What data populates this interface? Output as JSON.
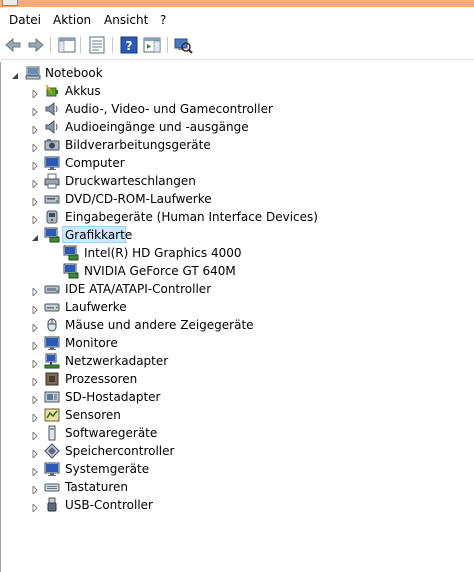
{
  "menubar": {
    "items": [
      {
        "label": "Datei"
      },
      {
        "label": "Aktion"
      },
      {
        "label": "Ansicht"
      },
      {
        "label": "?"
      }
    ]
  },
  "toolbar": {
    "buttons": [
      {
        "icon": "back-arrow-icon"
      },
      {
        "icon": "forward-arrow-icon"
      },
      {
        "icon": "console-tree-icon"
      },
      {
        "icon": "properties-icon"
      },
      {
        "icon": "help-icon"
      },
      {
        "icon": "action-pane-icon"
      },
      {
        "icon": "scan-hardware-icon"
      }
    ]
  },
  "tree": {
    "root": {
      "label": "Notebook",
      "icon": "computer-icon",
      "expanded": true
    },
    "categories": [
      {
        "label": "Akkus",
        "icon": "battery-icon",
        "expanded": false
      },
      {
        "label": "Audio-, Video- und Gamecontroller",
        "icon": "speaker-icon",
        "expanded": false
      },
      {
        "label": "Audioeingänge und -ausgänge",
        "icon": "speaker-icon",
        "expanded": false
      },
      {
        "label": "Bildverarbeitungsgeräte",
        "icon": "camera-icon",
        "expanded": false
      },
      {
        "label": "Computer",
        "icon": "monitor-icon",
        "expanded": false
      },
      {
        "label": "Druckwarteschlangen",
        "icon": "printer-icon",
        "expanded": false
      },
      {
        "label": "DVD/CD-ROM-Laufwerke",
        "icon": "disc-drive-icon",
        "expanded": false
      },
      {
        "label": "Eingabegeräte (Human Interface Devices)",
        "icon": "hid-icon",
        "expanded": false
      },
      {
        "label": "Grafikkarte",
        "icon": "display-adapter-icon",
        "expanded": true,
        "selected": true,
        "children": [
          {
            "label": "Intel(R) HD Graphics 4000",
            "icon": "display-adapter-icon"
          },
          {
            "label": "NVIDIA GeForce GT 640M",
            "icon": "display-adapter-icon"
          }
        ]
      },
      {
        "label": "IDE ATA/ATAPI-Controller",
        "icon": "ide-controller-icon",
        "expanded": false
      },
      {
        "label": "Laufwerke",
        "icon": "hard-drive-icon",
        "expanded": false
      },
      {
        "label": "Mäuse und andere Zeigegeräte",
        "icon": "mouse-icon",
        "expanded": false
      },
      {
        "label": "Monitore",
        "icon": "monitor-icon",
        "expanded": false
      },
      {
        "label": "Netzwerkadapter",
        "icon": "network-icon",
        "expanded": false
      },
      {
        "label": "Prozessoren",
        "icon": "processor-icon",
        "expanded": false
      },
      {
        "label": "SD-Hostadapter",
        "icon": "sd-card-icon",
        "expanded": false
      },
      {
        "label": "Sensoren",
        "icon": "sensor-icon",
        "expanded": false
      },
      {
        "label": "Softwaregeräte",
        "icon": "software-device-icon",
        "expanded": false
      },
      {
        "label": "Speichercontroller",
        "icon": "storage-controller-icon",
        "expanded": false
      },
      {
        "label": "Systemgeräte",
        "icon": "system-device-icon",
        "expanded": false
      },
      {
        "label": "Tastaturen",
        "icon": "keyboard-icon",
        "expanded": false
      },
      {
        "label": "USB-Controller",
        "icon": "usb-icon",
        "expanded": false
      }
    ]
  },
  "colors": {
    "title_accent": "#f7a978",
    "selection_fill": "#cce8ff",
    "selection_border": "#99d1ff"
  }
}
